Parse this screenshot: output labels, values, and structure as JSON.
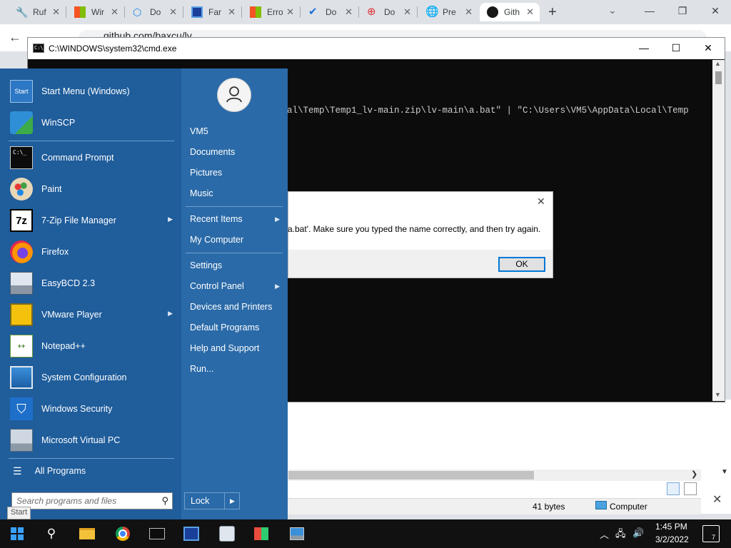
{
  "browser": {
    "tabs": [
      {
        "label": "Ruf",
        "icon": "rufus-icon"
      },
      {
        "label": "Wir",
        "icon": "windows-logo-icon"
      },
      {
        "label": "Do",
        "icon": "download-site-icon"
      },
      {
        "label": "Far",
        "icon": "far-manager-icon"
      },
      {
        "label": "Erro",
        "icon": "windows-logo-icon"
      },
      {
        "label": "Do",
        "icon": "checkmark-icon"
      },
      {
        "label": "Do",
        "icon": "target-icon"
      },
      {
        "label": "Pre",
        "icon": "globe-icon"
      },
      {
        "label": "Gith",
        "icon": "github-icon",
        "active": true
      }
    ],
    "new_tab": "+",
    "url": "github.com/baxcu/lv"
  },
  "cmd": {
    "title": "C:\\WINDOWS\\system32\\cmd.exe",
    "icon_text": "C:\\_",
    "output_line": "al\\Temp\\Temp1_lv-main.zip\\lv-main\\a.bat\" | \"C:\\Users\\VM5\\AppData\\Local\\Temp"
  },
  "dialog": {
    "message": "a.bat'. Make sure you typed the name correctly, and then try again.",
    "ok_label": "OK"
  },
  "background_window": {
    "status_size": "41 bytes",
    "status_location": "Computer"
  },
  "start_menu": {
    "programs": [
      {
        "label": "Start Menu (Windows)",
        "icon": "start-menu-icon"
      },
      {
        "label": "WinSCP",
        "icon": "winscp-icon"
      },
      {
        "label": "Command Prompt",
        "icon": "command-prompt-icon",
        "glyph": "C:\\_"
      },
      {
        "label": "Paint",
        "icon": "paint-palette-icon"
      },
      {
        "label": "7-Zip File Manager",
        "icon": "7zip-icon",
        "glyph": "7z",
        "submenu": true
      },
      {
        "label": "Firefox",
        "icon": "firefox-icon"
      },
      {
        "label": "EasyBCD 2.3",
        "icon": "easybcd-icon"
      },
      {
        "label": "VMware Player",
        "icon": "vmware-icon",
        "submenu": true
      },
      {
        "label": "Notepad++",
        "icon": "notepad-plus-plus-icon"
      },
      {
        "label": "System Configuration",
        "icon": "system-configuration-icon"
      },
      {
        "label": "Windows Security",
        "icon": "shield-icon"
      },
      {
        "label": "Microsoft Virtual PC",
        "icon": "virtual-pc-icon"
      }
    ],
    "start_icon_text": "Start",
    "all_programs": "All Programs",
    "search_placeholder": "Search programs and files",
    "start_tooltip": "Start",
    "right_items": [
      {
        "label": "VM5"
      },
      {
        "label": "Documents"
      },
      {
        "label": "Pictures"
      },
      {
        "label": "Music"
      },
      {
        "label": "Recent Items",
        "submenu": true
      },
      {
        "label": "My Computer"
      },
      {
        "label": "Settings"
      },
      {
        "label": "Control Panel",
        "submenu": true
      },
      {
        "label": "Devices and Printers"
      },
      {
        "label": "Default Programs"
      },
      {
        "label": "Help and Support"
      },
      {
        "label": "Run..."
      }
    ],
    "lock_label": "Lock"
  },
  "taskbar": {
    "time": "1:45 PM",
    "date": "3/2/2022",
    "notification_count": "7"
  },
  "colors": {
    "start_left": "#1f5d9b",
    "start_right": "#2a6aa8",
    "cmd_bg": "#0c0c0c",
    "taskbar": "#111111",
    "accent": "#0078d7"
  }
}
